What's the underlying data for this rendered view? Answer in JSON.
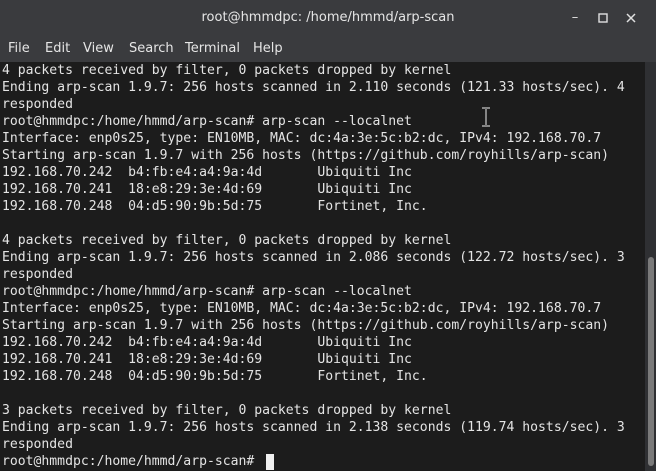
{
  "window": {
    "title": "root@hmmdpc: /home/hmmd/arp-scan",
    "controls": [
      "minimize-icon",
      "maximize-icon",
      "close-icon"
    ]
  },
  "menu": {
    "items": [
      "File",
      "Edit",
      "View",
      "Search",
      "Terminal",
      "Help"
    ]
  },
  "terminal": {
    "lines": [
      "4 packets received by filter, 0 packets dropped by kernel",
      "Ending arp-scan 1.9.7: 256 hosts scanned in 2.110 seconds (121.33 hosts/sec). 4",
      "responded",
      "root@hmmdpc:/home/hmmd/arp-scan# arp-scan --localnet",
      "Interface: enp0s25, type: EN10MB, MAC: dc:4a:3e:5c:b2:dc, IPv4: 192.168.70.7",
      "Starting arp-scan 1.9.7 with 256 hosts (https://github.com/royhills/arp-scan)",
      "192.168.70.242  b4:fb:e4:a4:9a:4d       Ubiquiti Inc",
      "192.168.70.241  18:e8:29:3e:4d:69       Ubiquiti Inc",
      "192.168.70.248  04:d5:90:9b:5d:75       Fortinet, Inc.",
      "",
      "4 packets received by filter, 0 packets dropped by kernel",
      "Ending arp-scan 1.9.7: 256 hosts scanned in 2.086 seconds (122.72 hosts/sec). 3",
      "responded",
      "root@hmmdpc:/home/hmmd/arp-scan# arp-scan --localnet",
      "Interface: enp0s25, type: EN10MB, MAC: dc:4a:3e:5c:b2:dc, IPv4: 192.168.70.7",
      "Starting arp-scan 1.9.7 with 256 hosts (https://github.com/royhills/arp-scan)",
      "192.168.70.242  b4:fb:e4:a4:9a:4d       Ubiquiti Inc",
      "192.168.70.241  18:e8:29:3e:4d:69       Ubiquiti Inc",
      "192.168.70.248  04:d5:90:9b:5d:75       Fortinet, Inc.",
      "",
      "3 packets received by filter, 0 packets dropped by kernel",
      "Ending arp-scan 1.9.7: 256 hosts scanned in 2.138 seconds (119.74 hosts/sec). 3",
      "responded",
      "root@hmmdpc:/home/hmmd/arp-scan# "
    ]
  },
  "colors": {
    "terminal_bg": "#1c1c1c",
    "terminal_fg": "#e4e4e4",
    "chrome_bg": "#3a3b3e"
  }
}
